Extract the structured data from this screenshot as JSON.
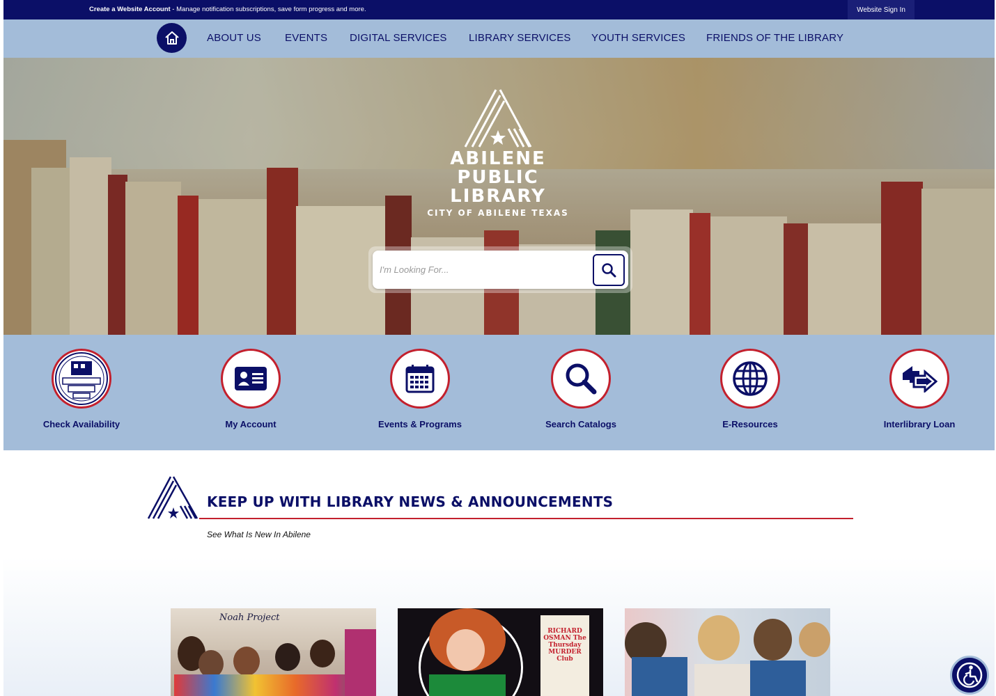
{
  "topbar": {
    "create_account_label": "Create a Website Account",
    "create_account_desc": " - Manage notification subscriptions, save form progress and more.",
    "sign_in_label": "Website Sign In"
  },
  "nav": {
    "items": [
      {
        "label": "ABOUT US"
      },
      {
        "label": "EVENTS"
      },
      {
        "label": "DIGITAL SERVICES"
      },
      {
        "label": "LIBRARY SERVICES"
      },
      {
        "label": "YOUTH SERVICES"
      },
      {
        "label": "FRIENDS OF THE LIBRARY"
      }
    ]
  },
  "hero": {
    "logo_line1": "ABILENE",
    "logo_line2": "PUBLIC",
    "logo_line3": "LIBRARY",
    "logo_sub": "CITY OF ABILENE TEXAS",
    "search_placeholder": "I'm Looking For..."
  },
  "quick_links": [
    {
      "label": "Check Availability",
      "icon": "imagination-library-icon"
    },
    {
      "label": "My Account",
      "icon": "id-card-icon"
    },
    {
      "label": "Events & Programs",
      "icon": "calendar-icon"
    },
    {
      "label": "Search Catalogs",
      "icon": "magnifier-icon"
    },
    {
      "label": "E-Resources",
      "icon": "globe-icon"
    },
    {
      "label": "Interlibrary Loan",
      "icon": "transfer-arrow-icon"
    }
  ],
  "news": {
    "title": "KEEP UP WITH LIBRARY NEWS & ANNOUNCEMENTS",
    "subtitle": "See What Is New In Abilene"
  },
  "cards": [
    {
      "caption": "Noah Project"
    },
    {
      "caption": "RICHARD OSMAN The Thursday MURDER Club"
    },
    {
      "caption": ""
    }
  ],
  "colors": {
    "navy": "#0b0f67",
    "light_blue": "#a3bcd9",
    "red": "#c3202d"
  }
}
